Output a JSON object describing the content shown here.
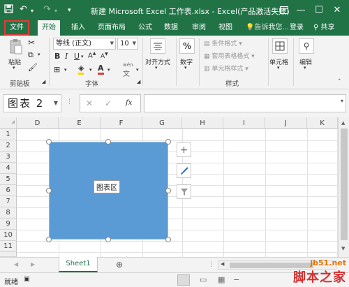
{
  "window": {
    "title": "新建 Microsoft Excel 工作表.xlsx - Excel(产品激活失败)"
  },
  "tabs": [
    "文件",
    "开始",
    "插入",
    "页面布局",
    "公式",
    "数据",
    "审阅",
    "视图"
  ],
  "tell_me": "告诉我您...",
  "login": "登录",
  "share": "共享",
  "ribbon": {
    "paste_label": "粘贴",
    "clipboard_group": "剪贴板",
    "font_name": "等线 (正文)",
    "font_size": "10",
    "font_group": "字体",
    "align_label": "对齐方式",
    "number_label": "数字",
    "cond_format": "条件格式",
    "table_format": "套用表格格式",
    "cell_style": "单元格样式",
    "style_group": "样式",
    "cells_label": "单元格",
    "edit_label": "编辑",
    "bold": "B",
    "italic": "I",
    "underline": "U",
    "font_color_letter": "A",
    "wen": "wén"
  },
  "formula_bar": {
    "name_box": "图表 2",
    "fx": "fx",
    "formula": ""
  },
  "columns": [
    "D",
    "E",
    "F",
    "G",
    "H",
    "I",
    "J",
    "K"
  ],
  "rows": [
    "1",
    "2",
    "3",
    "4",
    "5",
    "6",
    "7",
    "8",
    "9",
    "10",
    "11"
  ],
  "chart": {
    "area_label": "图表区",
    "fill_color": "#5b9bd5"
  },
  "sheets": {
    "active": "Sheet1"
  },
  "status": {
    "text": "就绪"
  },
  "watermark": {
    "url": "jb51.net",
    "brand": "脚本之家"
  },
  "colors": {
    "excel_green": "#217346",
    "file_highlight": "#e53935"
  }
}
